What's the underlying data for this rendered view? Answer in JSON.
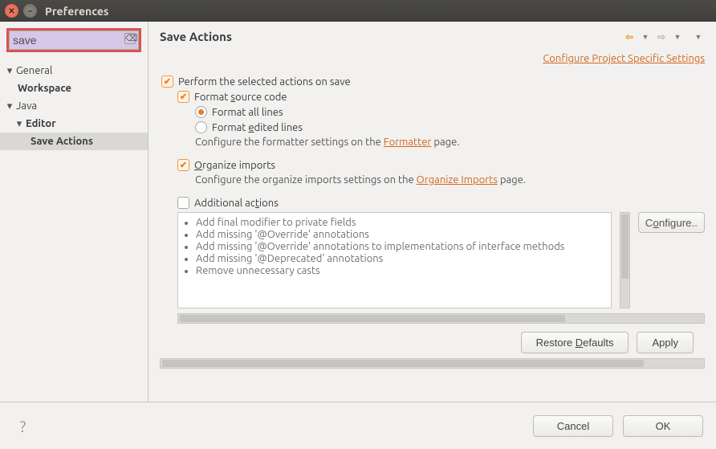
{
  "window": {
    "title": "Preferences"
  },
  "search": {
    "value": "save",
    "placeholder": ""
  },
  "tree": {
    "general": {
      "label": "General",
      "workspace": "Workspace"
    },
    "java": {
      "label": "Java",
      "editor": "Editor",
      "saveActions": "Save Actions"
    }
  },
  "page": {
    "title": "Save Actions",
    "configLink": "Configure Project Specific Settings",
    "performOnSave": "Perform the selected actions on save",
    "formatSource": "Format source code",
    "formatAllLines": "Format all lines",
    "formatEditedLines": "Format edited lines",
    "formatterHintPre": "Configure the formatter settings on the ",
    "formatterLink": "Formatter",
    "formatterHintPost": " page.",
    "organizeImports": "Organize imports",
    "organizeHintPre": "Configure the organize imports settings on the ",
    "organizeLink": "Organize Imports",
    "organizeHintPost": " page.",
    "additionalActions": "Additional actions",
    "additionalList": [
      "Add final modifier to private fields",
      "Add missing '@Override' annotations",
      "Add missing '@Override' annotations to implementations of interface methods",
      "Add missing '@Deprecated' annotations",
      "Remove unnecessary casts"
    ],
    "configureBtn": "Configure..",
    "restoreDefaults": "Restore Defaults",
    "apply": "Apply"
  },
  "buttons": {
    "cancel": "Cancel",
    "ok": "OK"
  }
}
